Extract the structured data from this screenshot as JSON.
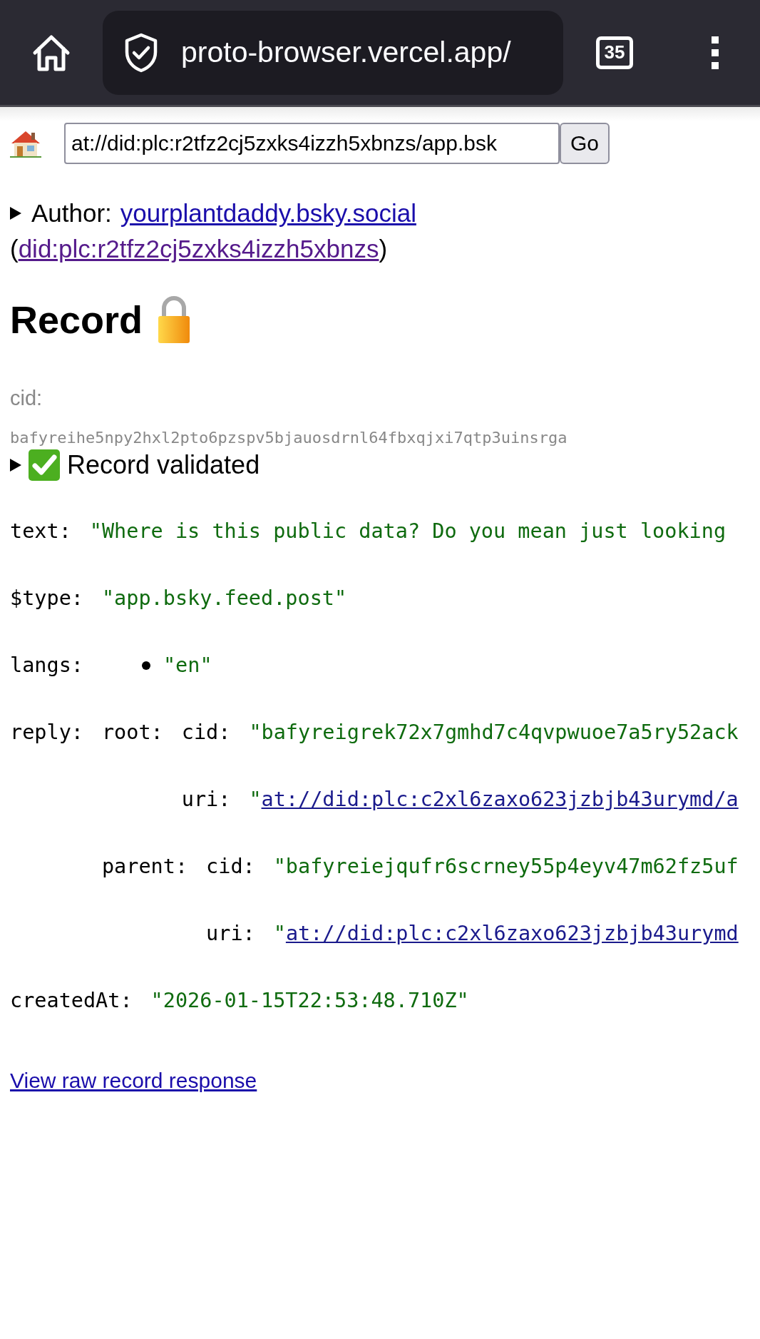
{
  "browser": {
    "url": "proto-browser.vercel.app/",
    "tab_count": "35"
  },
  "toolbar": {
    "address": "at://did:plc:r2tfz2cj5zxks4izzh5xbnzs/app.bsk",
    "go_button": "Go"
  },
  "author": {
    "label": "Author:",
    "handle": "yourplantdaddy.bsky.social",
    "open_paren": "(",
    "did": "did:plc:r2tfz2cj5zxks4izzh5xbnzs",
    "close_paren": ")"
  },
  "record": {
    "title": "Record",
    "cid_label": "cid:",
    "cid": "bafyreihe5npy2hxl2pto6pzspv5bjauosdrnl64fbxqjxi7qtp3uinsrga",
    "validation": "Record validated",
    "fields": [
      {
        "key": "text:",
        "kind": "string",
        "value": "\"Where is this public data? Do you mean just looking"
      },
      {
        "key": "$type:",
        "kind": "string",
        "value": "\"app.bsky.feed.post\""
      },
      {
        "key": "langs:",
        "kind": "list",
        "items": [
          "\"en\""
        ]
      },
      {
        "key": "reply:",
        "kind": "object",
        "children": [
          {
            "key": "root:",
            "kind": "object",
            "children": [
              {
                "key": "cid:",
                "kind": "string",
                "value": "\"bafyreigrek72x7gmhd7c4qvpwuoe7a5ry52ack"
              },
              {
                "key": "uri:",
                "kind": "link",
                "quote": "\"",
                "value": "at://did:plc:c2xl6zaxo623jzbjb43urymd/a"
              }
            ]
          },
          {
            "key": "parent:",
            "kind": "object",
            "children": [
              {
                "key": "cid:",
                "kind": "string",
                "value": "\"bafyreiejqufr6scrney55p4eyv47m62fz5uf"
              },
              {
                "key": "uri:",
                "kind": "link",
                "quote": "\"",
                "value": "at://did:plc:c2xl6zaxo623jzbjb43urymd"
              }
            ]
          }
        ]
      },
      {
        "key": "createdAt:",
        "kind": "string",
        "value": "\"2026-01-15T22:53:48.710Z\""
      }
    ]
  },
  "raw_link": "View raw record response"
}
